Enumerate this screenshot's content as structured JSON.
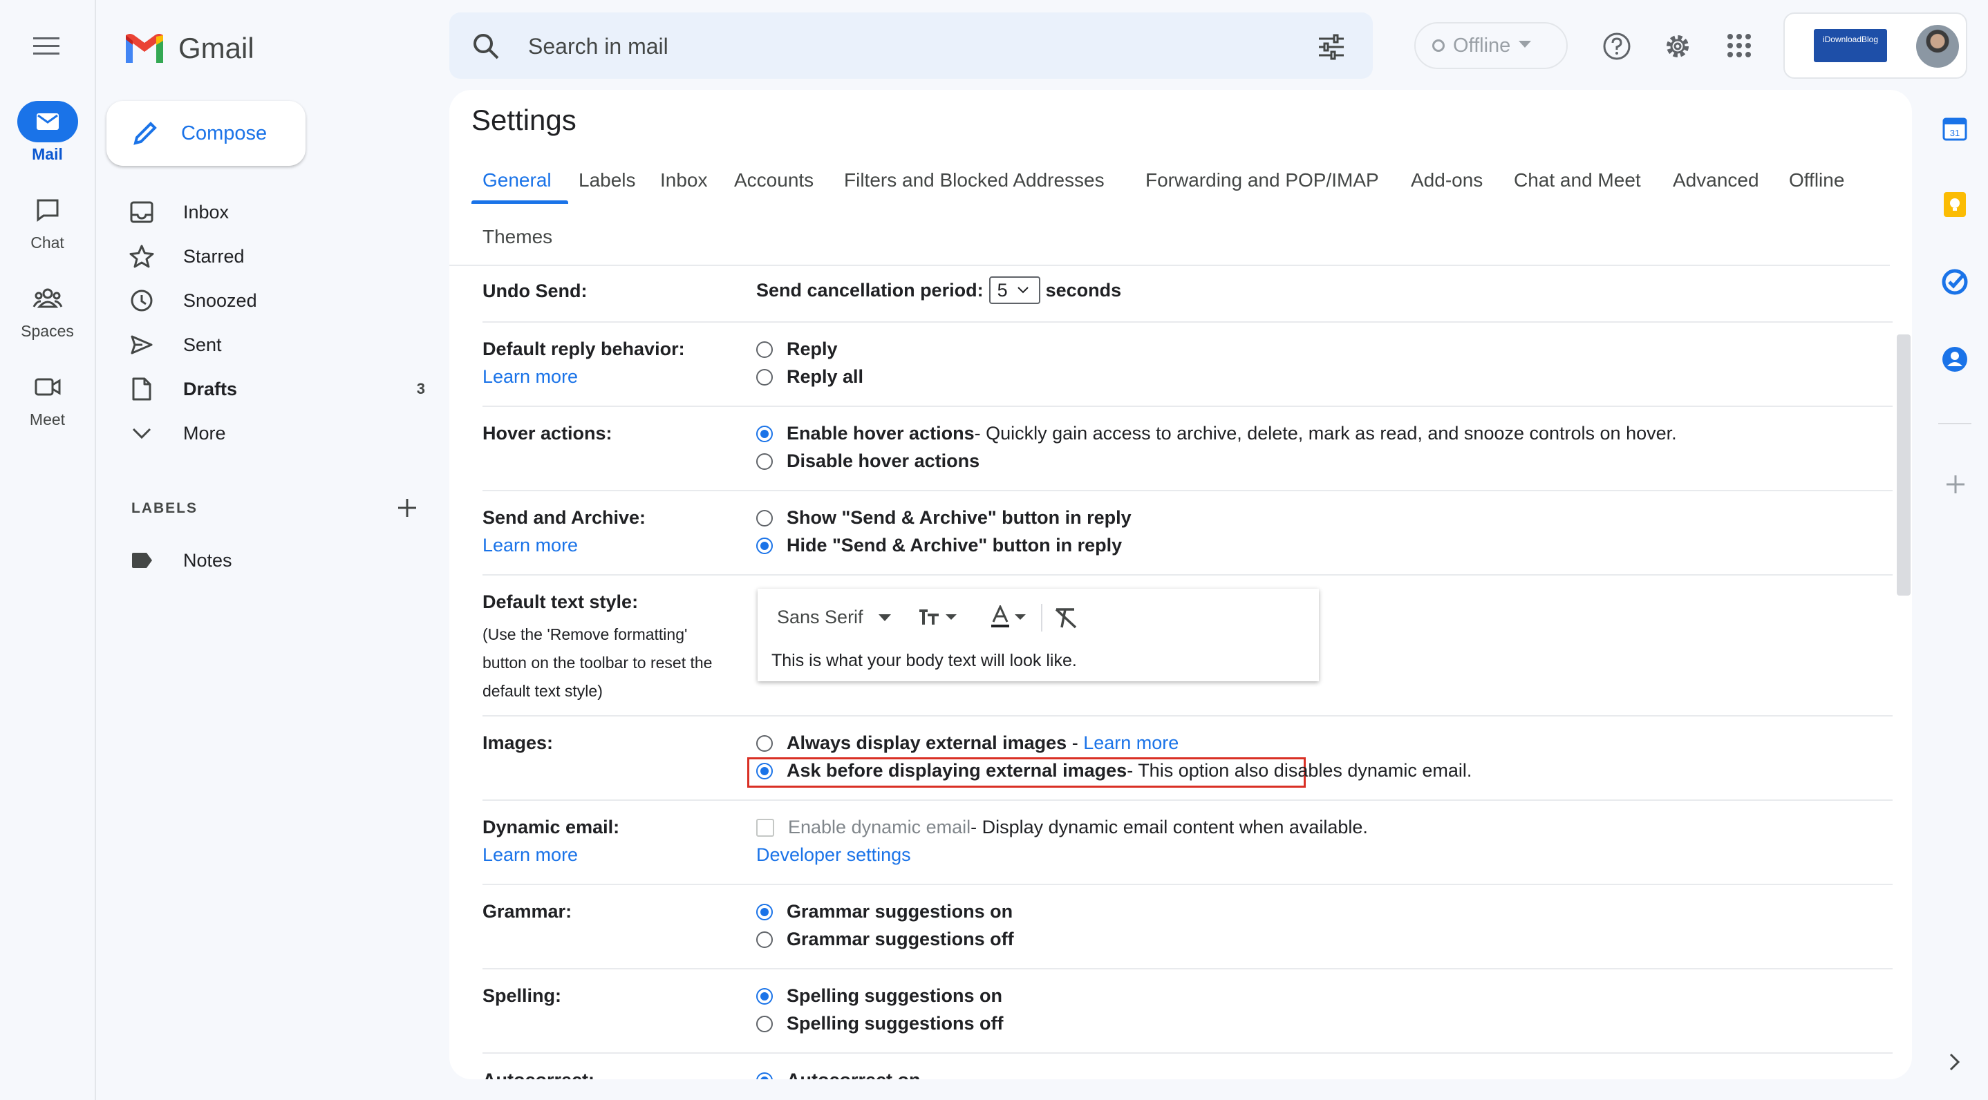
{
  "app": {
    "name": "Gmail"
  },
  "rail": [
    {
      "label": "Mail",
      "icon": "mail-icon",
      "active": true
    },
    {
      "label": "Chat",
      "icon": "chat-icon"
    },
    {
      "label": "Spaces",
      "icon": "spaces-icon"
    },
    {
      "label": "Meet",
      "icon": "meet-icon"
    }
  ],
  "compose": {
    "label": "Compose"
  },
  "nav": {
    "items": [
      {
        "label": "Inbox"
      },
      {
        "label": "Starred"
      },
      {
        "label": "Snoozed"
      },
      {
        "label": "Sent"
      },
      {
        "label": "Drafts",
        "count": "3"
      },
      {
        "label": "More"
      }
    ],
    "labels_header": "LABELS",
    "labels": [
      {
        "label": "Notes"
      }
    ]
  },
  "search": {
    "placeholder": "Search in mail"
  },
  "status": {
    "label": "Offline"
  },
  "account": {
    "badge_text": "iDownloadBlog"
  },
  "settings": {
    "title": "Settings",
    "tabs": [
      "General",
      "Labels",
      "Inbox",
      "Accounts",
      "Filters and Blocked Addresses",
      "Forwarding and POP/IMAP",
      "Add-ons",
      "Chat and Meet",
      "Advanced",
      "Offline",
      "Themes"
    ],
    "undo_send": {
      "label": "Undo Send:",
      "prefix": "Send cancellation period:",
      "value": "5",
      "suffix": "seconds"
    },
    "reply": {
      "label": "Default reply behavior:",
      "link": "Learn more",
      "options": [
        "Reply",
        "Reply all"
      ]
    },
    "hover": {
      "label": "Hover actions:",
      "opt1": "Enable hover actions",
      "opt1_desc": " - Quickly gain access to archive, delete, mark as read, and snooze controls on hover.",
      "opt2": "Disable hover actions"
    },
    "send_archive": {
      "label": "Send and Archive:",
      "link": "Learn more",
      "opt1": "Show \"Send & Archive\" button in reply",
      "opt2": "Hide \"Send & Archive\" button in reply"
    },
    "text_style": {
      "label": "Default text style:",
      "note_lines": [
        "(Use the 'Remove formatting'",
        "button on the toolbar to reset the",
        "default text style)"
      ],
      "font": "Sans Serif",
      "preview": "This is what your body text will look like."
    },
    "images": {
      "label": "Images:",
      "opt1": "Always display external images",
      "opt1_sep": " - ",
      "opt1_link": "Learn more",
      "opt2": "Ask before displaying external images",
      "opt2_desc": " - This option also disables dynamic email."
    },
    "dynamic": {
      "label": "Dynamic email:",
      "link": "Learn more",
      "opt": "Enable dynamic email",
      "opt_desc": " - Display dynamic email content when available.",
      "dev_link": "Developer settings"
    },
    "grammar": {
      "label": "Grammar:",
      "opt1": "Grammar suggestions on",
      "opt2": "Grammar suggestions off"
    },
    "spelling": {
      "label": "Spelling:",
      "opt1": "Spelling suggestions on",
      "opt2": "Spelling suggestions off"
    },
    "autocorrect": {
      "label": "Autocorrect:",
      "opt1": "Autocorrect on"
    }
  },
  "colors": {
    "accent": "#1a73e8",
    "highlight_box": "#d93025"
  }
}
